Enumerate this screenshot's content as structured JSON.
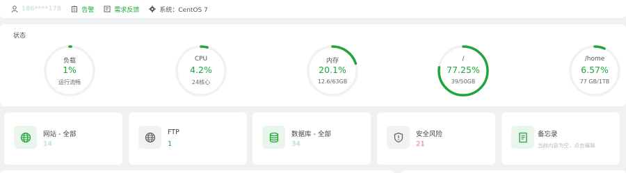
{
  "topbar": {
    "user": "186****178",
    "alarm": "告警",
    "feedback": "需求反馈",
    "system": "系统：CentOS 7"
  },
  "status": {
    "title": "状态",
    "gauges": [
      {
        "label": "负载",
        "value": "1%",
        "sub": "运行流畅",
        "percent": 1
      },
      {
        "label": "CPU",
        "value": "4.2%",
        "sub": "24核心",
        "percent": 4.2
      },
      {
        "label": "内存",
        "value": "20.1%",
        "sub": "12.6/63GB",
        "percent": 20.1
      },
      {
        "label": "/",
        "value": "77.25%",
        "sub": "39/50GB",
        "percent": 77.25
      },
      {
        "label": "/home",
        "value": "6.57%",
        "sub": "77 GB/1TB",
        "percent": 6.57
      }
    ]
  },
  "cards": [
    {
      "title": "网站 - 全部",
      "value": "14",
      "icon": "globe-icon"
    },
    {
      "title": "FTP",
      "value": "1",
      "icon": "globe-icon"
    },
    {
      "title": "数据库 - 全部",
      "value": "34",
      "icon": "database-icon"
    },
    {
      "title": "安全风险",
      "value": "21",
      "icon": "shield-icon"
    },
    {
      "title": "备忘录",
      "hint": "当前内容为空，点击编辑",
      "icon": "memo-icon"
    }
  ],
  "colors": {
    "accent": "#20a53a",
    "track": "#f1f1f1",
    "risk": "#e06a6a"
  }
}
